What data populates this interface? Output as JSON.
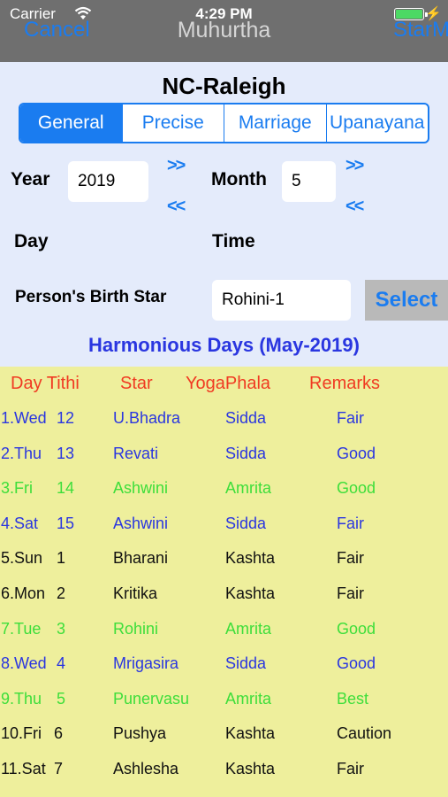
{
  "status_bar": {
    "carrier": "Carrier",
    "time": "4:29 PM"
  },
  "nav": {
    "cancel_label": "Cancel",
    "title": "Muhurtha",
    "right_label": "StarM"
  },
  "location": "NC-Raleigh",
  "tabs": [
    {
      "label": "General",
      "selected": true
    },
    {
      "label": "Precise",
      "selected": false
    },
    {
      "label": "Marriage",
      "selected": false
    },
    {
      "label": "Upanayana",
      "selected": false
    }
  ],
  "form": {
    "year_label": "Year",
    "year_value": "2019",
    "month_label": "Month",
    "month_value": "5",
    "next_symbol": ">>",
    "prev_symbol": "<<",
    "day_label": "Day",
    "time_label": "Time",
    "birth_star_label": "Person's Birth Star",
    "birth_star_value": "Rohini-1",
    "select_label": "Select"
  },
  "results_title": "Harmonious Days (May-2019)",
  "colors": {
    "normal": "#2a36e0",
    "highlight": "#3dde3a",
    "neutral": "#111111",
    "header": "#f03a22"
  },
  "table": {
    "headers": [
      "Day Tithi",
      "Star",
      "YogaPhala",
      "Remarks"
    ],
    "rows": [
      {
        "day": "1.Wed",
        "tithi": "12",
        "star": "U.Bhadra",
        "yoga": "Sidda",
        "remark": "Fair",
        "tone": "normal"
      },
      {
        "day": "2.Thu",
        "tithi": "13",
        "star": "Revati",
        "yoga": "Sidda",
        "remark": "Good",
        "tone": "normal"
      },
      {
        "day": "3.Fri",
        "tithi": "14",
        "star": "Ashwini",
        "yoga": "Amrita",
        "remark": "Good",
        "tone": "highlight"
      },
      {
        "day": "4.Sat",
        "tithi": "15",
        "star": "Ashwini",
        "yoga": "Sidda",
        "remark": "Fair",
        "tone": "normal"
      },
      {
        "day": "5.Sun",
        "tithi": "1",
        "star": "Bharani",
        "yoga": "Kashta",
        "remark": "Fair",
        "tone": "neutral"
      },
      {
        "day": "6.Mon",
        "tithi": "2",
        "star": "Kritika",
        "yoga": "Kashta",
        "remark": "Fair",
        "tone": "neutral"
      },
      {
        "day": "7.Tue",
        "tithi": "3",
        "star": "Rohini",
        "yoga": "Amrita",
        "remark": "Good",
        "tone": "highlight"
      },
      {
        "day": "8.Wed",
        "tithi": "4",
        "star": "Mrigasira",
        "yoga": "Sidda",
        "remark": "Good",
        "tone": "normal"
      },
      {
        "day": "9.Thu",
        "tithi": "5",
        "star": "Punervasu",
        "yoga": "Amrita",
        "remark": "Best",
        "tone": "highlight"
      },
      {
        "day": "10.Fri",
        "tithi": "6",
        "star": "Pushya",
        "yoga": "Kashta",
        "remark": "Caution",
        "tone": "neutral"
      },
      {
        "day": "11.Sat",
        "tithi": "7",
        "star": "Ashlesha",
        "yoga": "Kashta",
        "remark": "Fair",
        "tone": "neutral"
      }
    ]
  }
}
